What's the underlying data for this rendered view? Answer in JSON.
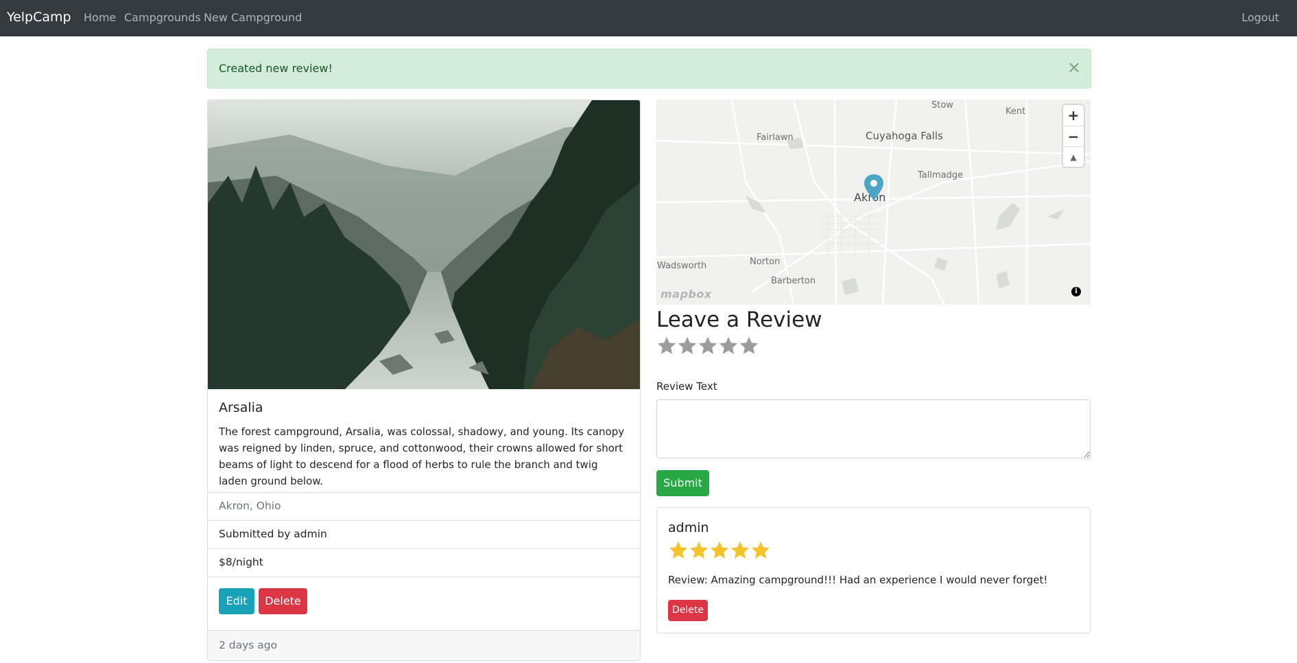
{
  "navbar": {
    "brand": "YelpCamp",
    "links": [
      "Home",
      "Campgrounds",
      "New Campground"
    ],
    "logout": "Logout"
  },
  "alert": {
    "message": "Created new review!",
    "close": "×"
  },
  "campground": {
    "title": "Arsalia",
    "description": "The forest campground, Arsalia, was colossal, shadowy, and young. Its canopy was reigned by linden, spruce, and cottonwood, their crowns allowed for short beams of light to descend for a flood of herbs to rule the branch and twig laden ground below.",
    "location": "Akron, Ohio",
    "submitted_by": "Submitted by admin",
    "price": "$8/night",
    "edit_label": "Edit",
    "delete_label": "Delete",
    "posted": "2 days ago"
  },
  "map": {
    "labels": [
      "Stow",
      "Kent",
      "Fairlawn",
      "Cuyahoga Falls",
      "Tallmadge",
      "Akron",
      "Wadsworth",
      "Norton",
      "Barberton"
    ],
    "zoom_in": "+",
    "zoom_out": "−",
    "compass": "▲",
    "attribution_logo": "mapbox",
    "info": "i",
    "marker_color": "#4aa6c4"
  },
  "review_form": {
    "heading": "Leave a Review",
    "rating": 0,
    "rating_max": 5,
    "text_label": "Review Text",
    "text_value": "",
    "submit_label": "Submit"
  },
  "reviews": [
    {
      "author": "admin",
      "rating": 5,
      "text": "Review: Amazing campground!!! Had an experience I would never forget!",
      "delete_label": "Delete"
    }
  ],
  "colors": {
    "navbar": "#343a40",
    "alert_bg": "#d4edda",
    "alert_text": "#155724",
    "edit": "#17a2b8",
    "delete": "#dc3545",
    "submit": "#28a745",
    "star_filled": "#f4c22b",
    "star_empty": "#9c9c9c"
  }
}
